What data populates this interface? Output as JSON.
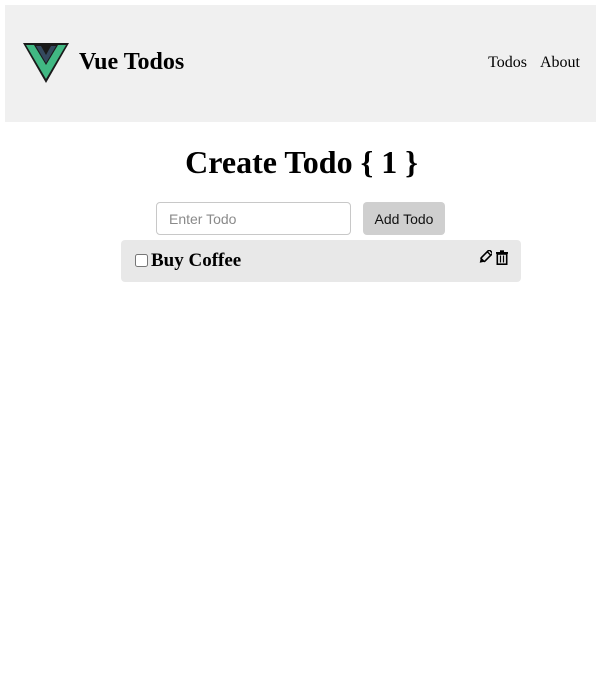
{
  "header": {
    "brand_title": "Vue Todos",
    "logo_icon": "vue-logo-icon",
    "nav": [
      {
        "label": "Todos"
      },
      {
        "label": "About"
      }
    ]
  },
  "main": {
    "title": "Create Todo { 1 }",
    "input": {
      "placeholder": "Enter Todo",
      "value": ""
    },
    "add_button_label": "Add Todo",
    "todos": [
      {
        "text": "Buy Coffee",
        "completed": false,
        "edit_icon": "pencil-icon",
        "delete_icon": "trash-icon"
      }
    ]
  },
  "colors": {
    "header_bg": "#f0f0f0",
    "todo_bg": "#e8e8e8",
    "button_bg": "#cfcfcf",
    "logo_green": "#41b883",
    "logo_dark": "#34495e"
  }
}
